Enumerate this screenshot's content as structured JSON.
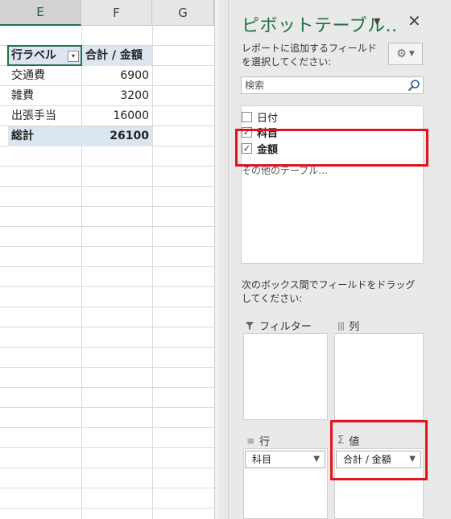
{
  "sheet": {
    "columns": [
      "E",
      "F",
      "G"
    ],
    "pivot_header": {
      "row_label": "行ラベル",
      "value_label": "合計 / 金額"
    },
    "rows": [
      {
        "label": "交通費",
        "value": "6900"
      },
      {
        "label": "雑費",
        "value": "3200"
      },
      {
        "label": "出張手当",
        "value": "16000"
      }
    ],
    "total": {
      "label": "総計",
      "value": "26100"
    }
  },
  "pivot_panel": {
    "title": "ピボットテーブル..",
    "description": "レポートに追加するフィールドを選択してください:",
    "search_placeholder": "検索",
    "fields": [
      {
        "label": "日付",
        "checked": false
      },
      {
        "label": "科目",
        "checked": true
      },
      {
        "label": "金額",
        "checked": true
      }
    ],
    "more_tables": "その他のテーブル...",
    "drag_instruction": "次のボックス間でフィールドをドラッグしてください:",
    "areas": {
      "filters": "フィルター",
      "columns": "列",
      "rows": "行",
      "values": "値"
    },
    "row_item": "科目",
    "value_item": "合計 / 金額"
  },
  "colors": {
    "accent": "#217346",
    "highlight": "#e0141e",
    "pivot_header_bg": "#dce6f1"
  }
}
